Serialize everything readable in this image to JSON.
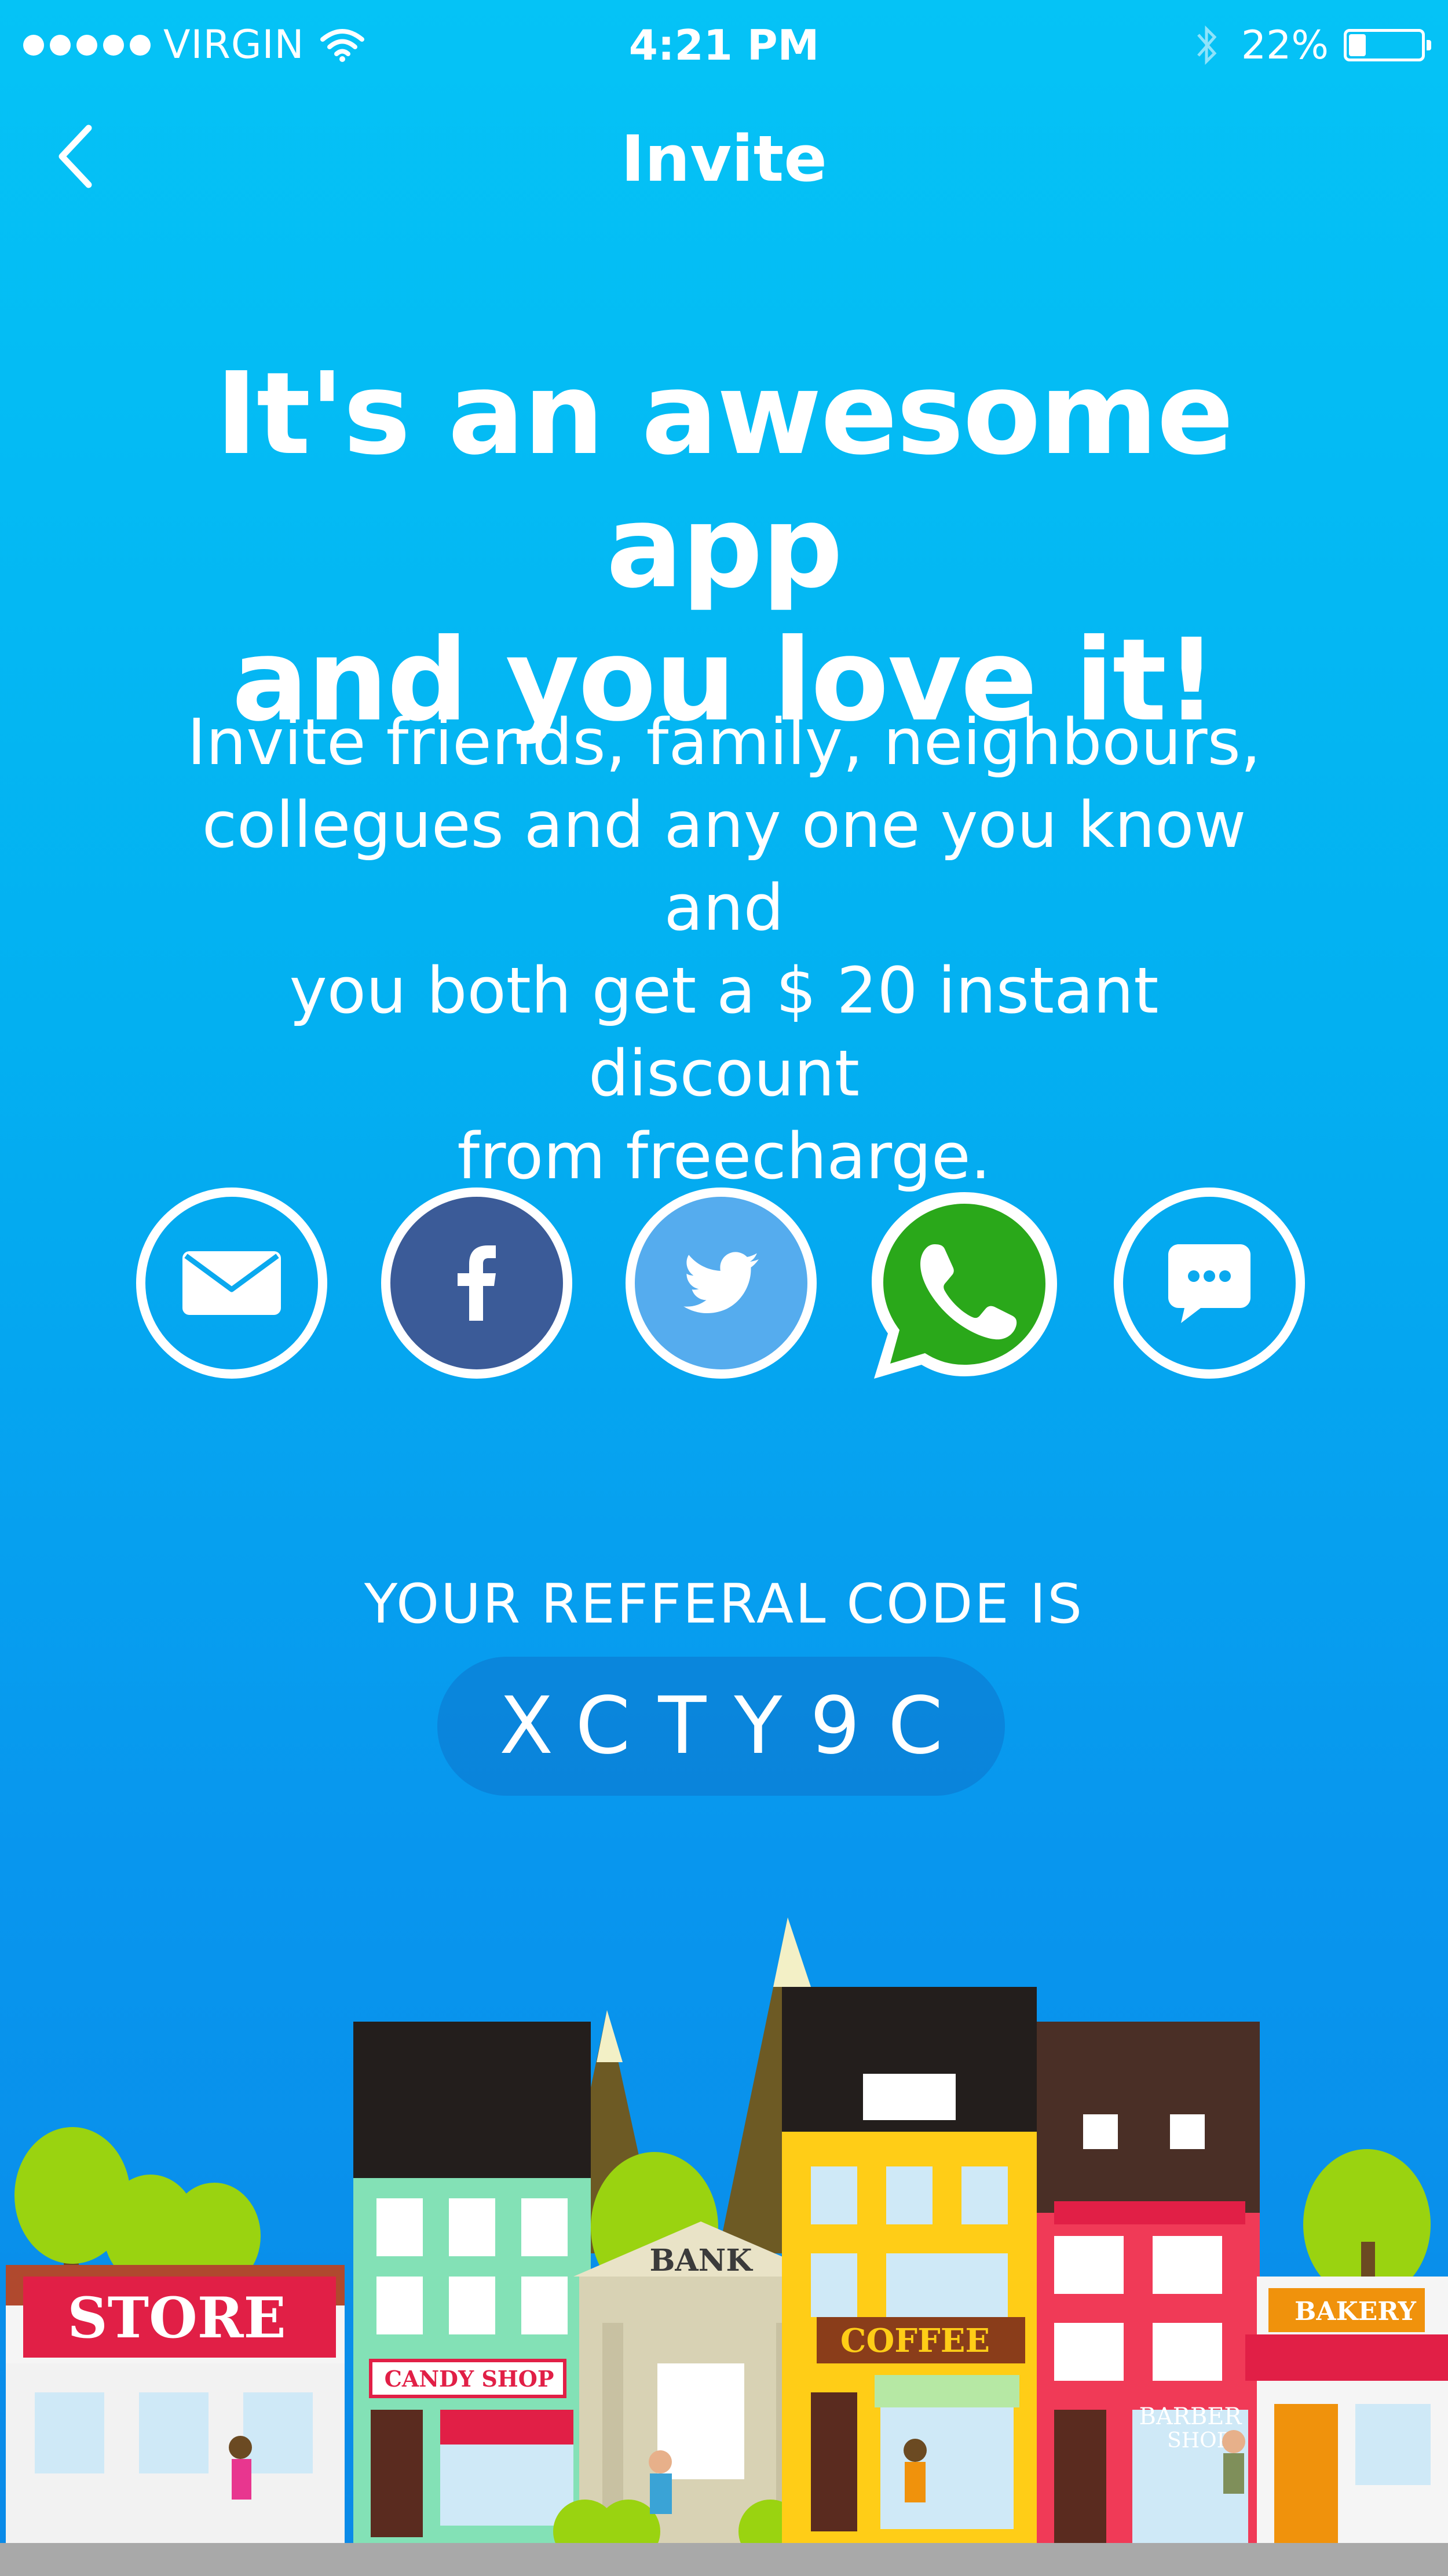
{
  "status_bar": {
    "carrier": "VIRGIN",
    "time": "4:21 PM",
    "battery_percent": "22%",
    "battery_level": 0.22
  },
  "nav": {
    "title": "Invite"
  },
  "headline": {
    "line1": "It's an awesome app",
    "line2": "and you love it!"
  },
  "description": {
    "line1": "Invite friends, family, neighbours,",
    "line2": "collegues and any one you know and",
    "line3": "you both get a $ 20 instant discount",
    "line4": "from freecharge."
  },
  "share": [
    {
      "name": "email",
      "icon": "mail-icon"
    },
    {
      "name": "facebook",
      "icon": "facebook-icon",
      "color": "#3b5b98"
    },
    {
      "name": "twitter",
      "icon": "twitter-icon",
      "color": "#55acee"
    },
    {
      "name": "whatsapp",
      "icon": "whatsapp-icon",
      "color": "#2aa81a"
    },
    {
      "name": "message",
      "icon": "chat-bubble-icon"
    }
  ],
  "referral": {
    "label": "YOUR REFFERAL CODE IS",
    "code": "XCTY9C"
  },
  "illustration": {
    "signs": {
      "store": "STORE",
      "candy_shop": "CANDY SHOP",
      "bank": "BANK",
      "coffee": "COFFEE",
      "bakery": "BAKERY",
      "barber_line1": "BARBER",
      "barber_line2": "SHOP"
    }
  },
  "colors": {
    "background_top": "#05c3f6",
    "background_bottom": "#0a8ae8",
    "facebook": "#3b5b98",
    "twitter": "#55acee",
    "whatsapp": "#2aa81a"
  }
}
